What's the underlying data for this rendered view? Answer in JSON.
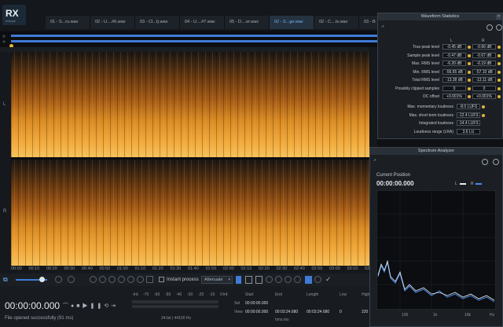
{
  "app": {
    "logo_text": "RX",
    "logo_sub": "izotope"
  },
  "tabs": [
    {
      "label": "01 - S...ru.wav"
    },
    {
      "label": "02 - U....#6.wav"
    },
    {
      "label": "03 - Cl...t).wav"
    },
    {
      "label": "04 - U....#7.wav"
    },
    {
      "label": "05 - D....er.wav"
    },
    {
      "label": "02 - S...ge.wav",
      "active": true
    },
    {
      "label": "02 - C....ls.wav"
    },
    {
      "label": "03 - B"
    }
  ],
  "channels": {
    "left": "L",
    "right": "R"
  },
  "time_axis": [
    "00:00",
    "00:10",
    "00:20",
    "00:30",
    "00:40",
    "00:50",
    "01:00",
    "01:10",
    "01:20",
    "01:30",
    "01:40",
    "01:50",
    "02:00",
    "02:10",
    "02:20",
    "02:30",
    "02:40",
    "02:50",
    "03:00",
    "03:10",
    "03:2"
  ],
  "toolbar": {
    "instant_process": "Instant process",
    "mode": "Attenuate"
  },
  "transport": {
    "timecode": "00:00:00.000"
  },
  "status": {
    "message": "File opened successfully (91 ms)",
    "format": "24-bit | 44100 Hz"
  },
  "meter": {
    "inf": "-Inf.",
    "scale": [
      "-70",
      "-60",
      "-50",
      "-40",
      "-30",
      "-20",
      "-10",
      "0"
    ],
    "inf2": "-Inf."
  },
  "selection": {
    "headers": [
      "Start",
      "End",
      "Length",
      "Low",
      "High"
    ],
    "sel_label": "Sel",
    "view_label": "View",
    "sel_start": "00:00:00.000",
    "view_start": "00:00:00.000",
    "view_end": "00:03:24.680",
    "view_length": "00:03:24.680",
    "low": "0",
    "high": "220",
    "unit": "hms.ms"
  },
  "filename_short": "h:m:s.ms",
  "waveform_stats": {
    "title": "Waveform Statistics",
    "col_left": "L",
    "col_right": "R",
    "rows": [
      {
        "label": "True peak level",
        "l": "-0.45 dB",
        "r": "-0.66 dB"
      },
      {
        "label": "Sample peak level",
        "l": "-0.47 dB",
        "r": "-0.67 dB"
      },
      {
        "label": "Max. RMS level",
        "l": "-6.20 dB",
        "r": "-6.19 dB"
      },
      {
        "label": "Min. RMS level",
        "l": "-56.65 dB",
        "r": "-57.10 dB"
      },
      {
        "label": "Total RMS level",
        "l": "-13.38 dB",
        "r": "-13.11 dB"
      },
      {
        "label": "Possibly clipped samples",
        "l": "0",
        "r": "0"
      },
      {
        "label": "DC offset",
        "l": "+0.001%",
        "r": "+0.001%"
      }
    ],
    "loudness": [
      {
        "label": "Max. momentary loudness",
        "v": "-8.0 LUFS"
      },
      {
        "label": "Max. short-term loudness",
        "v": "-12.4 LUFS"
      },
      {
        "label": "Integrated loudness",
        "v": "-14.4 LUFS"
      },
      {
        "label": "Loudness range (LRA)",
        "v": "3.6 LU"
      }
    ]
  },
  "spectrum": {
    "title": "Spectrum Analyzer",
    "current_position_label": "Current Position",
    "current_position": "00:00:00.000",
    "legend_l": "L",
    "legend_r": "R",
    "x_ticks": [
      "100",
      "1k",
      "10k",
      "Hz"
    ]
  },
  "colors": {
    "accent": "#3f7bd6",
    "left_line": "#e8ecf0",
    "right_line": "#4b8bea",
    "warn": "#e2b23a"
  }
}
